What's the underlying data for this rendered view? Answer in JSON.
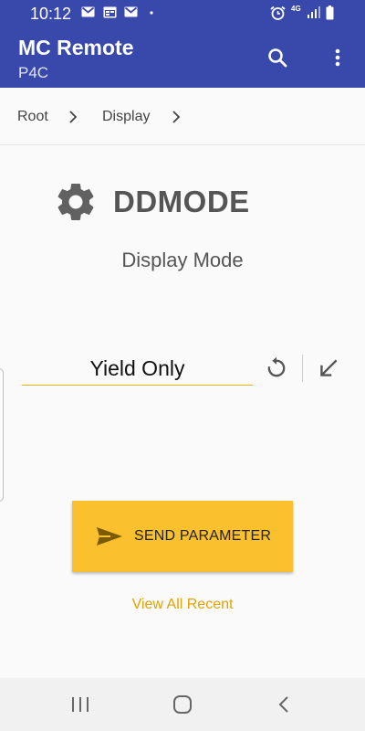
{
  "status_bar": {
    "time": "10:12",
    "icons": [
      "gmail-icon",
      "calendar-icon",
      "mail-icon",
      "dot-icon",
      "alarm-icon",
      "4g-icon",
      "signal-icon",
      "battery-icon"
    ],
    "network": "4G"
  },
  "app_bar": {
    "title": "MC Remote",
    "subtitle": "P4C",
    "actions": [
      "search-icon",
      "more-vert-icon"
    ]
  },
  "breadcrumb": {
    "items": [
      "Root",
      "Display"
    ],
    "separator_icon": "chevron-right-icon"
  },
  "parameter": {
    "icon": "gear-icon",
    "name": "DDMODE",
    "description": "Display Mode",
    "value": "Yield Only",
    "reset_icon": "undo-icon",
    "apply_icon": "arrow-down-left-icon"
  },
  "send_button": {
    "icon": "send-icon",
    "label": "SEND PARAMETER"
  },
  "recent_link": "View All Recent",
  "nav_bar": {
    "buttons": [
      "recents-icon",
      "home-icon",
      "back-icon"
    ]
  },
  "colors": {
    "primary": "#3949ab",
    "accent": "#fbc02d",
    "link": "#e2a300",
    "underline": "#f4b400"
  }
}
